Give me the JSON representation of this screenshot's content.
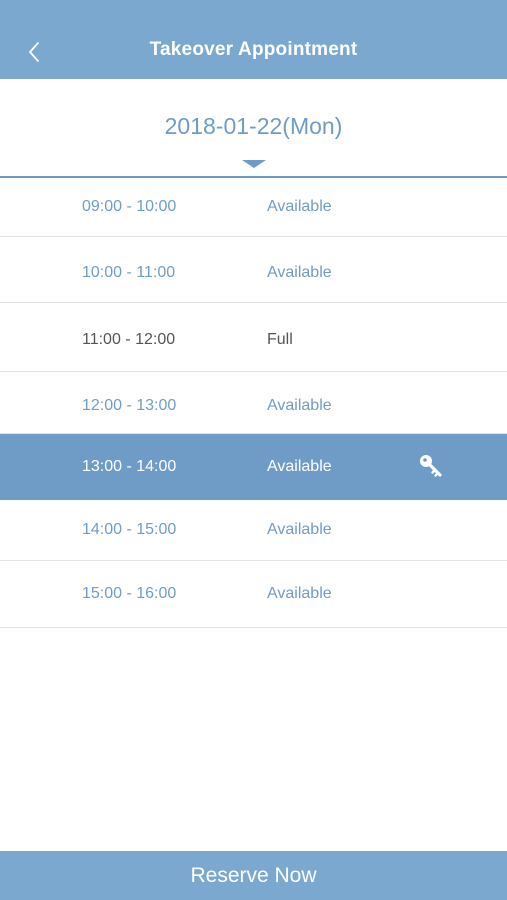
{
  "header": {
    "title": "Takeover Appointment",
    "back_icon": "chevron-left-icon"
  },
  "date_selector": {
    "date": "2018-01-22(Mon)",
    "caret_icon": "caret-down-icon"
  },
  "slots": [
    {
      "time": "09:00 - 10:00",
      "status": "Available"
    },
    {
      "time": "10:00 - 11:00",
      "status": "Available"
    },
    {
      "time": "11:00 - 12:00",
      "status": "Full"
    },
    {
      "time": "12:00 - 13:00",
      "status": "Available"
    },
    {
      "time": "13:00 - 14:00",
      "status": "Available",
      "selected": true,
      "icon": "key-icon"
    },
    {
      "time": "14:00 - 15:00",
      "status": "Available"
    },
    {
      "time": "15:00 - 16:00",
      "status": "Available"
    }
  ],
  "reserve_button": {
    "label": "Reserve Now"
  },
  "colors": {
    "accent": "#6f9cc7",
    "header_bg": "#7aa8cf",
    "full_text": "#555555",
    "divider": "#e3e3e3"
  }
}
